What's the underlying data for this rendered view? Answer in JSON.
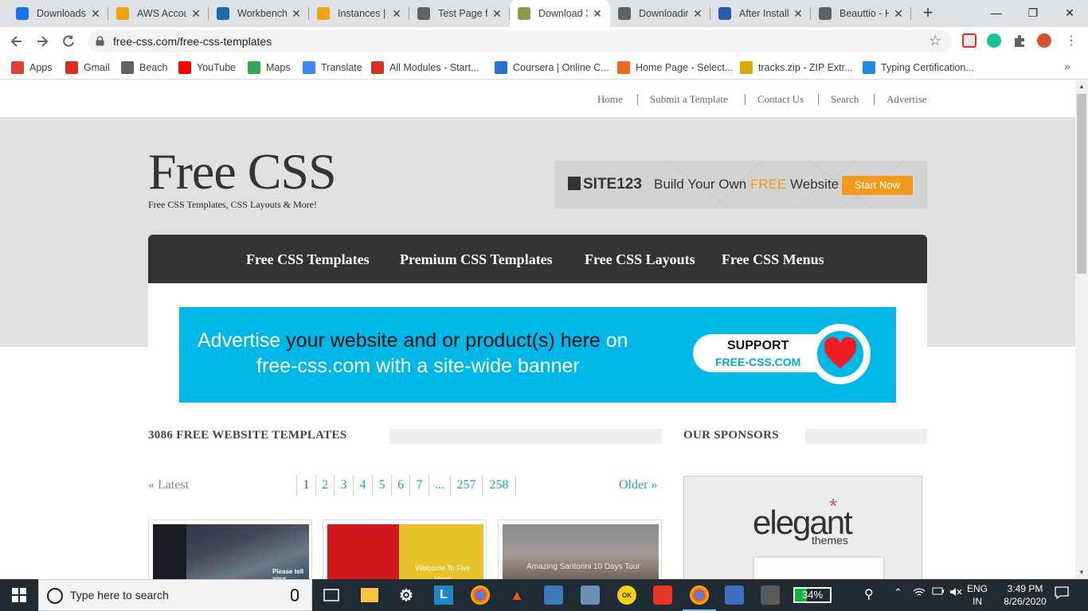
{
  "browser": {
    "tabs": [
      {
        "title": "Downloads",
        "icon": "download-icon",
        "color": "#1a73e8"
      },
      {
        "title": "AWS Accou",
        "icon": "aws-icon",
        "color": "#f0a30a"
      },
      {
        "title": "Workbench",
        "icon": "vcode-icon",
        "color": "#1b6ba8"
      },
      {
        "title": "Instances | E",
        "icon": "aws-icon",
        "color": "#f0a30a"
      },
      {
        "title": "Test Page fo",
        "icon": "globe-icon",
        "color": "#5f6368"
      },
      {
        "title": "Download 3",
        "icon": "css-icon",
        "color": "#8b9a4a",
        "active": true
      },
      {
        "title": "Downloadin",
        "icon": "globe-icon",
        "color": "#5f6368"
      },
      {
        "title": "After Install",
        "icon": "server-icon",
        "color": "#2b5aa8"
      },
      {
        "title": "Beauttio - H",
        "icon": "globe-icon",
        "color": "#5f6368"
      }
    ],
    "close_glyph": "✕",
    "new_tab_glyph": "+",
    "window_controls": {
      "minimize": "—",
      "restore": "❐",
      "close": "✕"
    },
    "url": "free-css.com/free-css-templates",
    "bookmarks": [
      {
        "label": "Apps",
        "icon": "apps-grid-icon",
        "color": "#e34133"
      },
      {
        "label": "Gmail",
        "icon": "gmail-icon",
        "color": "#d93025"
      },
      {
        "label": "Beach",
        "icon": "globe-icon",
        "color": "#5f6368"
      },
      {
        "label": "YouTube",
        "icon": "youtube-icon",
        "color": "#ff0000"
      },
      {
        "label": "Maps",
        "icon": "maps-icon",
        "color": "#34a853"
      },
      {
        "label": "Translate",
        "icon": "translate-icon",
        "color": "#4285f4"
      },
      {
        "label": "All Modules - Start...",
        "icon": "modules-icon",
        "color": "#d93025"
      },
      {
        "label": "Coursera | Online C...",
        "icon": "coursera-icon",
        "color": "#2a73cc"
      },
      {
        "label": "Home Page - Select...",
        "icon": "select-icon",
        "color": "#f26522"
      },
      {
        "label": "tracks.zip - ZIP Extr...",
        "icon": "zip-icon",
        "color": "#e0a800"
      },
      {
        "label": "Typing Certification...",
        "icon": "typing-icon",
        "color": "#1e88e5"
      }
    ],
    "bookmarks_overflow": "»"
  },
  "site": {
    "topnav": [
      "Home",
      "Submit a Template",
      "Contact Us",
      "Search",
      "Advertise"
    ],
    "logo": "Free CSS",
    "tagline": "Free CSS Templates, CSS Layouts & More!",
    "site123_ad": {
      "brand": "SITE123",
      "msg_before": "Build Your Own ",
      "msg_free": "FREE",
      "msg_after": " Website",
      "cta": "Start Now"
    },
    "mainnav": [
      "Free CSS Templates",
      "Premium CSS Templates",
      "Free CSS Layouts",
      "Free CSS Menus"
    ],
    "ad_banner": {
      "l1_a": "Advertise ",
      "l1_b": "your website and or product(s) here",
      "l1_c": " on",
      "line2": "free-css.com with a site-wide banner",
      "support": "SUPPORT",
      "support_site": "FREE-CSS.COM"
    },
    "templates_heading": "3086 FREE WEBSITE TEMPLATES",
    "sponsors_heading": "OUR SPONSORS",
    "pager": {
      "latest": "« Latest",
      "older": "Older »",
      "pages": [
        "1",
        "2",
        "3",
        "4",
        "5",
        "6",
        "7",
        "...",
        "257",
        "258"
      ],
      "current": "1"
    },
    "thumbs": [
      {
        "caption": "Please tell your friends"
      },
      {
        "caption": "Welcome To Five Hotel"
      },
      {
        "caption": "Amazing Santorini 10 Days Tour"
      }
    ],
    "sponsor": {
      "name": "elegant",
      "sub": "themes",
      "mark": "*"
    }
  },
  "taskbar": {
    "search_placeholder": "Type here to search",
    "battery": "34%",
    "battery_level": 0.34,
    "lang": [
      "ENG",
      "IN"
    ],
    "time": "3:49 PM",
    "date": "8/26/2020"
  }
}
